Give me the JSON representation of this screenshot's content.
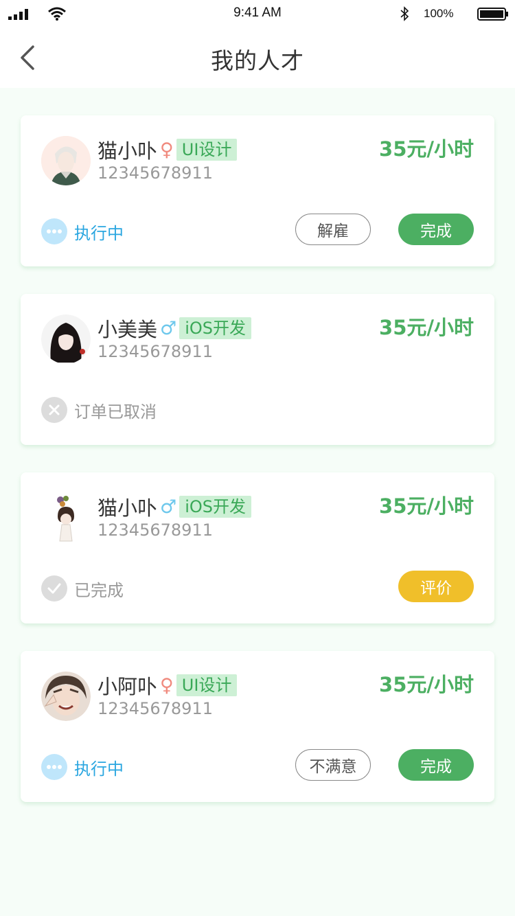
{
  "status_bar": {
    "time": "9:41 AM",
    "battery": "100%"
  },
  "nav": {
    "title": "我的人才"
  },
  "cards": [
    {
      "name": "猫小卟",
      "gender": "♀",
      "tag": "UI设计",
      "phone": "12345678911",
      "price": "35元/小时",
      "status": "执行中",
      "buttons": [
        "解雇",
        "完成"
      ]
    },
    {
      "name": "小美美",
      "gender": "♂",
      "tag": "iOS开发",
      "phone": "12345678911",
      "price": "35元/小时",
      "status": "订单已取消",
      "buttons": []
    },
    {
      "name": "猫小卟",
      "gender": "♂",
      "tag": "iOS开发",
      "phone": "12345678911",
      "price": "35元/小时",
      "status": "已完成",
      "buttons": [
        "评价"
      ]
    },
    {
      "name": "小阿卟",
      "gender": "♀",
      "tag": "UI设计",
      "phone": "12345678911",
      "price": "35元/小时",
      "status": "执行中",
      "buttons": [
        "不满意",
        "完成"
      ]
    }
  ],
  "colors": {
    "accent_green": "#4caf62",
    "exec_blue": "#2aa6e0",
    "rate_yellow": "#f0bf2a",
    "female": "#f08a7e",
    "male": "#6ec8ec"
  }
}
